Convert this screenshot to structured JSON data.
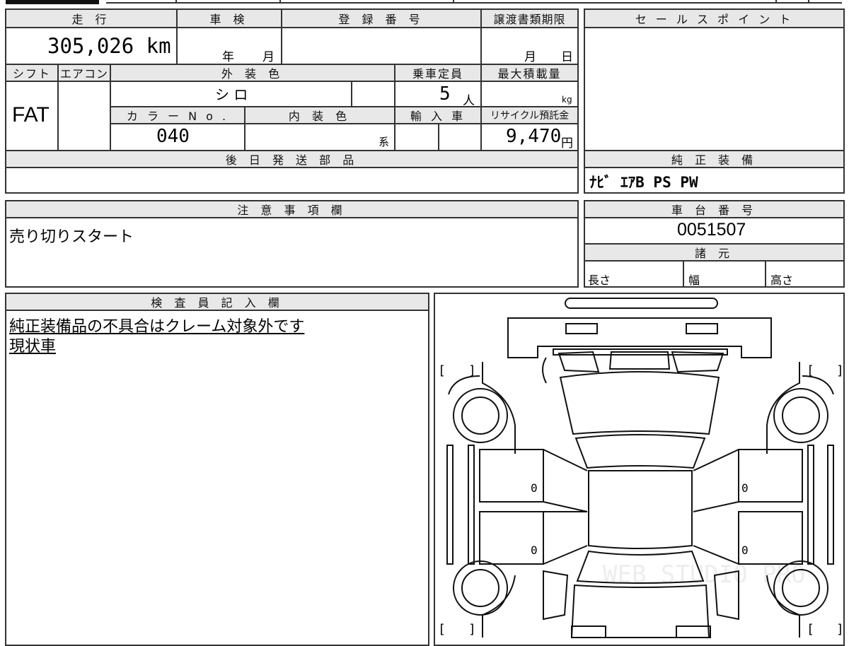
{
  "headers": {
    "mileage": "走 行",
    "inspection": "車 検",
    "registration": "登 録 番 号",
    "transfer_deadline": "譲渡書類期限",
    "sales_points": "セ ー ル ス ポ イ ン ト",
    "shift": "シフト",
    "aircon": "エアコン",
    "exterior_color": "外 装 色",
    "capacity": "乗車定員",
    "max_load": "最大積載量",
    "color_no": "カ ラ ー N o .",
    "interior_color": "内 装 色",
    "import": "輸 入 車",
    "recycle": "リサイクル預託金",
    "later_parts": "後 日 発 送 部 品",
    "genuine_equipment": "純 正 装 備",
    "notes": "注 意 事 項 欄",
    "chassis_no": "車 台 番 号",
    "specs": "諸 元",
    "inspector": "検 査 員 記 入 欄"
  },
  "values": {
    "mileage": "305,026 km",
    "year_label": "年",
    "month_label": "月",
    "deadline_month": "月",
    "deadline_day": "日",
    "shift": "FAT",
    "exterior_color": "シ ロ",
    "capacity": "5",
    "capacity_unit": "人",
    "max_load_unit": "kg",
    "color_no": "040",
    "interior_suffix": "系",
    "recycle": "9,470",
    "recycle_unit": "円",
    "genuine_equipment": "ﾅﾋﾞ ｴｱB PS PW",
    "notes": "売り切りスタート",
    "chassis_no": "0051507",
    "spec_length": "長さ",
    "spec_width": "幅",
    "spec_height": "高さ",
    "inspector_line1": "純正装備品の不具合はクレーム対象外です",
    "inspector_line2": "現状車"
  },
  "diagram": {
    "door_marks": [
      "0",
      "0",
      "0",
      "0"
    ],
    "bracket_left": "[",
    "bracket_right": "]",
    "watermark": "WEB STUDIO PRO"
  }
}
